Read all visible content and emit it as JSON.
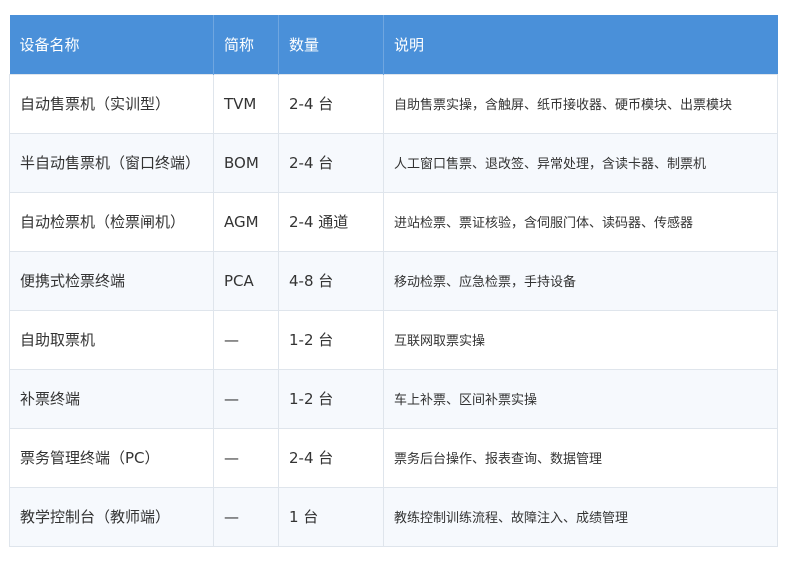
{
  "table": {
    "headers": [
      "设备名称",
      "简称",
      "数量",
      "说明"
    ],
    "rows": [
      [
        "自动售票机（实训型）",
        "TVM",
        "2-4 台",
        "自助售票实操，含触屏、纸币接收器、硬币模块、出票模块"
      ],
      [
        "半自动售票机（窗口终端）",
        "BOM",
        "2-4 台",
        "人工窗口售票、退改签、异常处理，含读卡器、制票机"
      ],
      [
        "自动检票机（检票闸机）",
        "AGM",
        "2-4 通道",
        "进站检票、票证核验，含伺服门体、读码器、传感器"
      ],
      [
        "便携式检票终端",
        "PCA",
        "4-8 台",
        "移动检票、应急检票，手持设备"
      ],
      [
        "自助取票机",
        "—",
        "1-2 台",
        "互联网取票实操"
      ],
      [
        "补票终端",
        "—",
        "1-2 台",
        "车上补票、区间补票实操"
      ],
      [
        "票务管理终端（PC）",
        "—",
        "2-4 台",
        "票务后台操作、报表查询、数据管理"
      ],
      [
        "教学控制台（教师端）",
        "—",
        "1 台",
        "教练控制训练流程、故障注入、成绩管理"
      ]
    ]
  },
  "colors": {
    "header_bg": "#4a90d9",
    "header_text": "#ffffff",
    "row_alt_bg": "#f6f9fd",
    "border": "#dfe5ec",
    "text": "#333333"
  }
}
